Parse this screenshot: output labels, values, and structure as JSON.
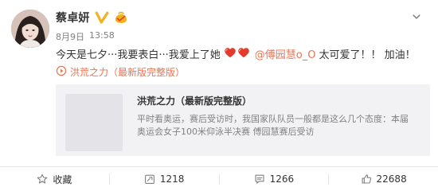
{
  "user": {
    "name": "蔡卓妍"
  },
  "meta": {
    "date": "8月9日",
    "time": "13:58"
  },
  "post": {
    "text_before_hearts": "今天是七夕···我要表白···我爱上了她",
    "mention": "@傅园慧o_O",
    "text_after_mention": "太可爱了！！ 加油！",
    "link_label": "洪荒之力（最新版完整版）"
  },
  "preview": {
    "title": "洪荒之力（最新版完整版）",
    "description": "平时看奥运，赛后受访时，我国家队队员一般都是这么几个态度：本届奥运会女子100米仰泳半决赛 傅园慧赛后受访"
  },
  "actions": {
    "favorite_label": "收藏",
    "share_count": "1218",
    "comment_count": "1266",
    "like_count": "22688"
  },
  "colors": {
    "accent": "#eb7350",
    "text_primary": "#333333",
    "text_secondary": "#808080",
    "border": "#e6e6e6",
    "card_bg": "#f2f2f5",
    "verified": "#f3b21d",
    "heart": "#e8392d"
  },
  "icons": {
    "verified": "verified-v-icon",
    "vip": "vip-badge-icon",
    "more": "chevron-down-icon",
    "link": "video-link-icon",
    "favorite": "star-icon",
    "share": "share-icon",
    "comment": "comment-icon",
    "like": "thumb-up-icon"
  }
}
